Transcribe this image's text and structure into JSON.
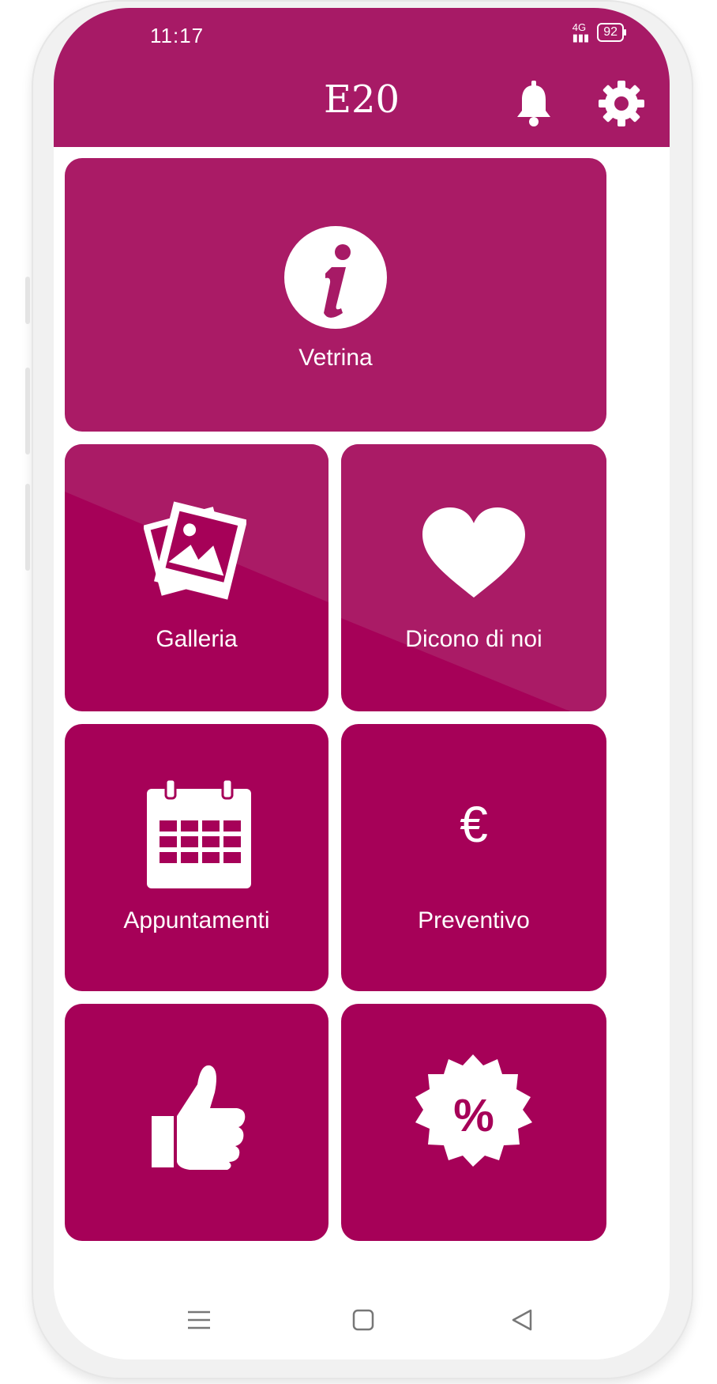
{
  "status_bar": {
    "time": "11:17",
    "network": "4G",
    "battery": "92"
  },
  "header": {
    "title": "E20",
    "bell_icon": "bell-icon",
    "gear_icon": "gear-icon"
  },
  "tiles": [
    {
      "label": "Vetrina",
      "icon": "info-icon"
    },
    {
      "label": "Galleria",
      "icon": "photos-icon"
    },
    {
      "label": "Dicono di noi",
      "icon": "heart-icon"
    },
    {
      "label": "Appuntamenti",
      "icon": "calendar-icon"
    },
    {
      "label": "Preventivo",
      "icon": "euro-icon",
      "icon_text": "€"
    },
    {
      "label": "",
      "icon": "thumbs-up-icon"
    },
    {
      "label": "",
      "icon": "discount-badge-icon",
      "icon_text": "%"
    }
  ],
  "nav_bar": {
    "menu_icon": "menu-lines-icon",
    "home_icon": "home-square-icon",
    "back_icon": "back-triangle-icon"
  },
  "colors": {
    "brand": "#a71a66",
    "tile": "#a60158",
    "tile_light": "#aa1b66",
    "white": "#ffffff"
  }
}
